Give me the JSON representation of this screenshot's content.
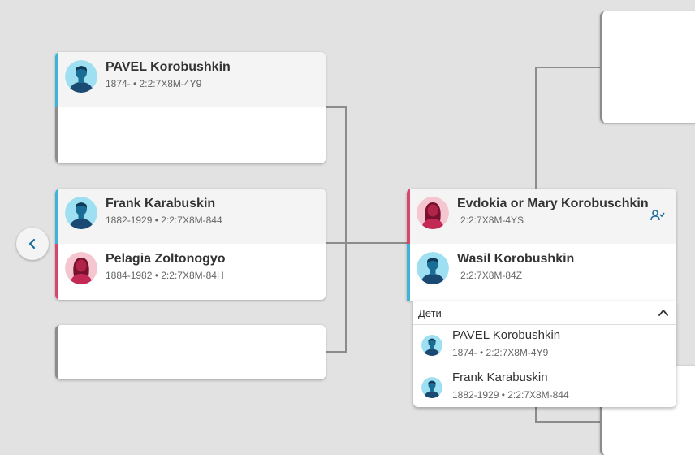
{
  "colors": {
    "background": "#e2e2e2",
    "male_accent": "#3bb4d8",
    "female_accent": "#d8466a",
    "connector": "#8c8c8c"
  },
  "tree": {
    "gen2_top": {
      "father": {
        "name": "PAVEL Korobushkin",
        "meta": "1874- • 2:2:7X8M-4Y9",
        "gender": "male"
      }
    },
    "gen1_couple": {
      "father": {
        "name": "Frank Karabuskin",
        "meta": "1882-1929 • 2:2:7X8M-844",
        "gender": "male"
      },
      "mother": {
        "name": "Pelagia Zoltonogyo",
        "meta": "1884-1982 • 2:2:7X8M-84H",
        "gender": "female"
      }
    },
    "focus_couple": {
      "person1": {
        "name": "Evdokia or Mary Korobuschkin",
        "meta": "2:2:7X8M-4YS",
        "gender": "female",
        "icon": "family-members-icon"
      },
      "person2": {
        "name": "Wasil Korobushkin",
        "meta": "2:2:7X8M-84Z",
        "gender": "male"
      }
    },
    "children": {
      "title": "Дети",
      "items": [
        {
          "name": "PAVEL Korobushkin",
          "meta": "1874- • 2:2:7X8M-4Y9"
        },
        {
          "name": "Frank Karabuskin",
          "meta": "1882-1929 • 2:2:7X8M-844"
        }
      ]
    }
  },
  "navigation": {
    "back_icon": "chevron-left-icon"
  }
}
